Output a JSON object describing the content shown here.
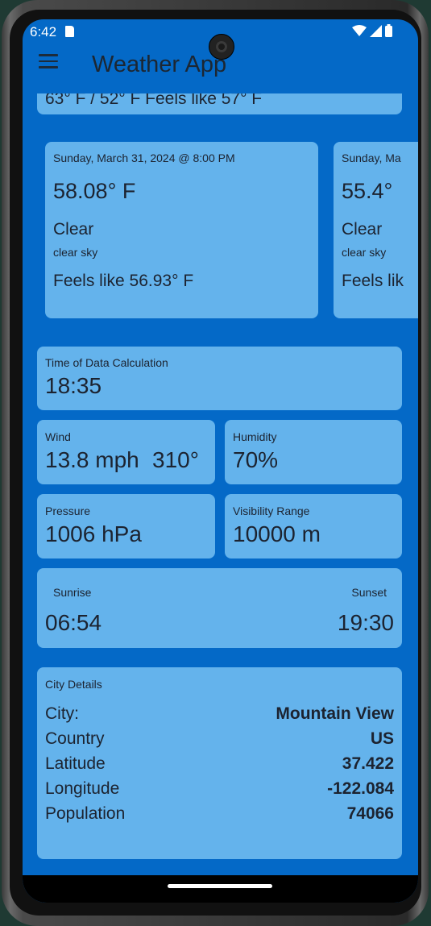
{
  "status_bar": {
    "time": "6:42"
  },
  "app_bar": {
    "title": "Weather App"
  },
  "partial_card": {
    "text": "63° F / 52° F Feels like 57° F"
  },
  "forecasts": [
    {
      "date": "Sunday, March 31, 2024 @ 8:00 PM",
      "temp": "58.08° F",
      "condition": "Clear",
      "description": "clear sky",
      "feels_like": "Feels like 56.93° F"
    },
    {
      "date": "Sunday, Ma",
      "temp": "55.4°",
      "condition": "Clear",
      "description": "clear sky",
      "feels_like": "Feels lik"
    }
  ],
  "time_of_calc": {
    "label": "Time of Data Calculation",
    "value": "18:35"
  },
  "wind": {
    "label": "Wind",
    "speed": "13.8 mph",
    "direction": "310°"
  },
  "humidity": {
    "label": "Humidity",
    "value": "70%"
  },
  "pressure": {
    "label": "Pressure",
    "value": "1006 hPa"
  },
  "visibility": {
    "label": "Visibility Range",
    "value": "10000 m"
  },
  "sun": {
    "sunrise_label": "Sunrise",
    "sunrise": "06:54",
    "sunset_label": "Sunset",
    "sunset": "19:30"
  },
  "city": {
    "title": "City Details",
    "rows": [
      {
        "key": "City:",
        "value": "Mountain View"
      },
      {
        "key": "Country",
        "value": "US"
      },
      {
        "key": "Latitude",
        "value": "37.422"
      },
      {
        "key": "Longitude",
        "value": "-122.084"
      },
      {
        "key": "Population",
        "value": "74066"
      }
    ]
  },
  "colors": {
    "background": "#0469c7",
    "card": "#64b3ec",
    "text": "#1c2330"
  }
}
